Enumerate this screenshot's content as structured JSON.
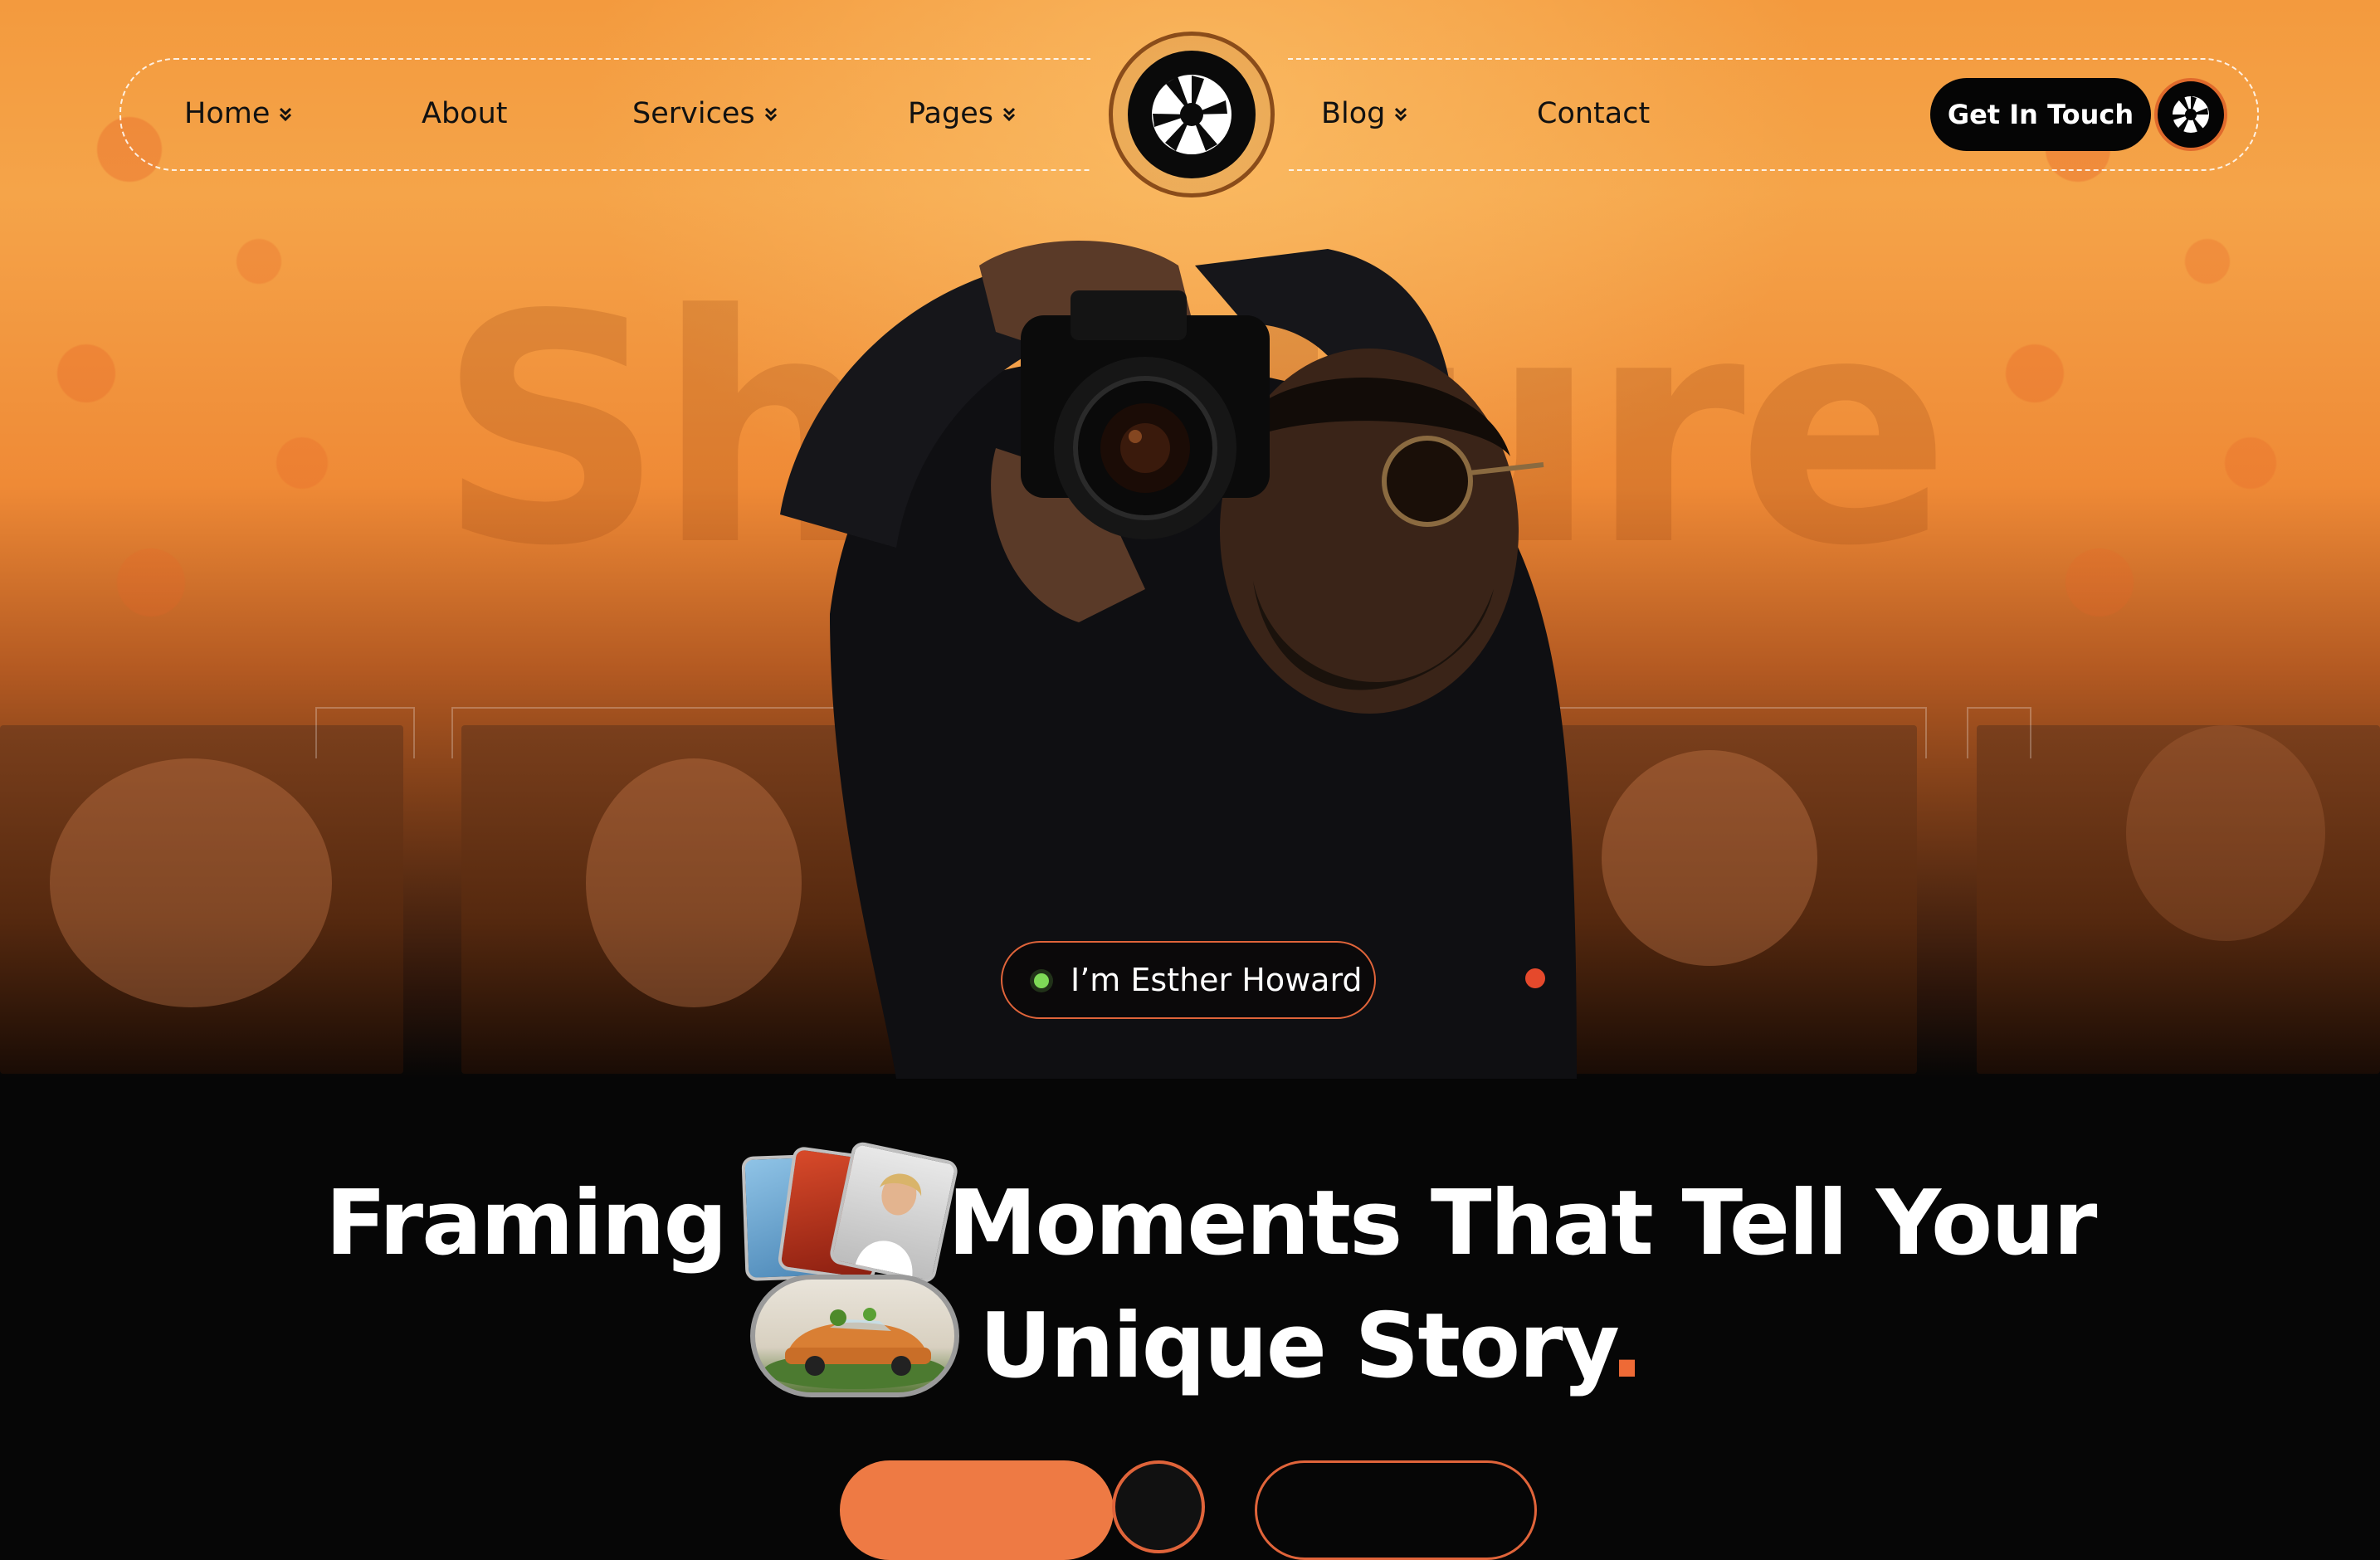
{
  "nav": {
    "items": [
      {
        "label": "Home",
        "has_dropdown": true
      },
      {
        "label": "About",
        "has_dropdown": false
      },
      {
        "label": "Services",
        "has_dropdown": true
      },
      {
        "label": "Pages",
        "has_dropdown": true
      },
      {
        "label": "Blog",
        "has_dropdown": true
      },
      {
        "label": "Contact",
        "has_dropdown": false
      }
    ],
    "cta_label": "Get In Touch"
  },
  "hero": {
    "background_word": "Shutture",
    "name_badge": "I’m Esther Howard"
  },
  "headline": {
    "line1_start": "Framing",
    "line1_end": "Moments That Tell Your",
    "line2": "Unique Story",
    "line2_dot": "."
  },
  "colors": {
    "accent": "#ee6a36",
    "hero_orange": "#f39a3e",
    "dark": "#060606",
    "online_green": "#7ed957"
  },
  "icons": {
    "logo": "camera-aperture-icon",
    "chevron": "double-chevron-down-icon"
  }
}
